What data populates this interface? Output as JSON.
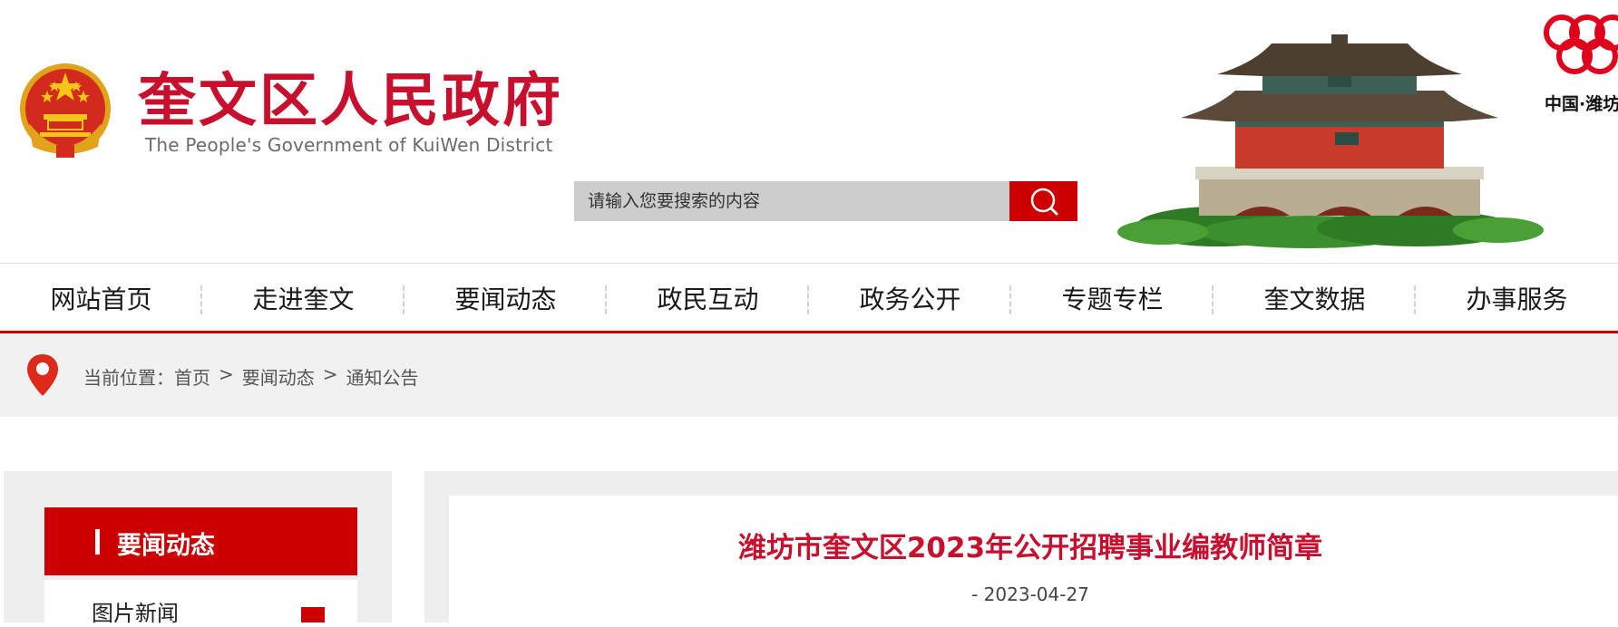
{
  "header": {
    "title": "奎文区人民政府",
    "subtitle": "The People's Government of KuiWen District",
    "search_placeholder": "请输入您要搜索的内容",
    "partner_logo_text": "中国·潍坊",
    "accent_color": "#cc0000"
  },
  "nav": {
    "items": [
      {
        "label": "网站首页"
      },
      {
        "label": "走进奎文"
      },
      {
        "label": "要闻动态"
      },
      {
        "label": "政民互动"
      },
      {
        "label": "政务公开"
      },
      {
        "label": "专题专栏"
      },
      {
        "label": "奎文数据"
      },
      {
        "label": "办事服务"
      }
    ]
  },
  "breadcrumb": {
    "prefix": "当前位置：",
    "items": [
      "首页",
      "要闻动态",
      "通知公告"
    ],
    "separator": ">"
  },
  "sidebar": {
    "title": "要闻动态",
    "items": [
      {
        "label": "图片新闻"
      }
    ]
  },
  "article": {
    "title": "潍坊市奎文区2023年公开招聘事业编教师简章",
    "date": "- 2023-04-27"
  }
}
